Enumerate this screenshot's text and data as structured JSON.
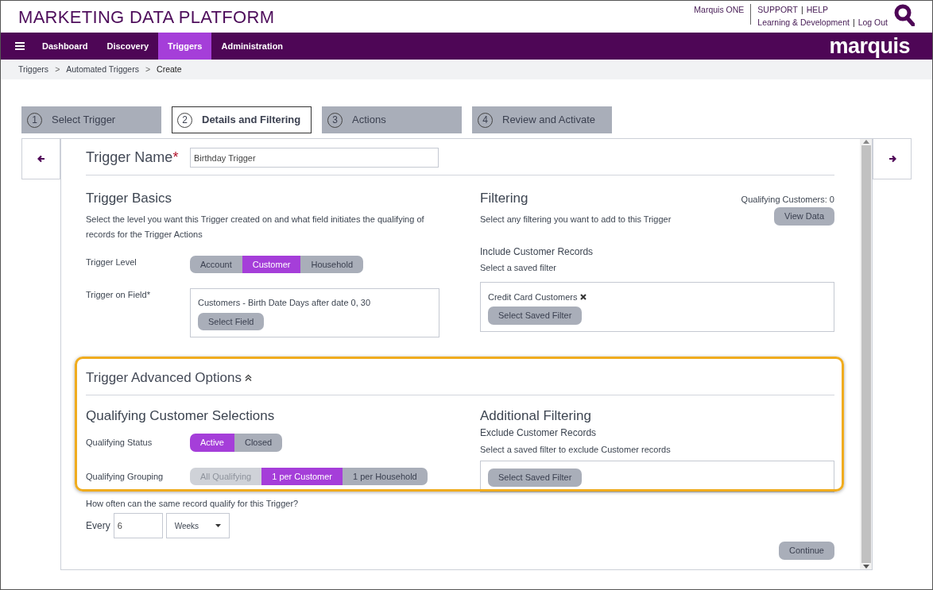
{
  "header": {
    "title": "MARKETING DATA PLATFORM",
    "account_link": "Marquis ONE",
    "link_rows": [
      [
        {
          "kind": "link",
          "label": "SUPPORT"
        },
        {
          "kind": "separator",
          "label": "|"
        },
        {
          "kind": "link",
          "label": "HELP"
        }
      ],
      [
        {
          "kind": "link",
          "label": "Learning & Development"
        },
        {
          "kind": "separator",
          "label": "|"
        },
        {
          "kind": "link",
          "label": "Log Out"
        }
      ]
    ]
  },
  "navbar": {
    "items": [
      {
        "label": "Dashboard",
        "selected": false
      },
      {
        "label": "Discovery",
        "selected": false
      },
      {
        "label": "Triggers",
        "selected": true
      },
      {
        "label": "Administration",
        "selected": false
      }
    ],
    "logo": "marquis"
  },
  "breadcrumb": [
    {
      "kind": "link",
      "label": "Triggers"
    },
    {
      "kind": "separator",
      "label": ">"
    },
    {
      "kind": "link",
      "label": "Automated Triggers"
    },
    {
      "kind": "separator",
      "label": ">"
    },
    {
      "kind": "current",
      "label": "Create"
    }
  ],
  "steps": [
    {
      "number": "1",
      "label": "Select Trigger",
      "selected": false
    },
    {
      "number": "2",
      "label": "Details and Filtering",
      "selected": true
    },
    {
      "number": "3",
      "label": "Actions",
      "selected": false
    },
    {
      "number": "4",
      "label": "Review and Activate",
      "selected": false
    }
  ],
  "trigger_name": {
    "label": "Trigger Name",
    "required_mark": "*",
    "value": "Birthday Trigger"
  },
  "trigger_basics": {
    "title": "Trigger Basics",
    "description": "Select the level you want this Trigger created on and what field initiates the qualifying of records for the Trigger Actions",
    "level_label": "Trigger Level",
    "level_options": [
      {
        "label": "Account",
        "selected": false,
        "disabled": false
      },
      {
        "label": "Customer",
        "selected": true,
        "disabled": false
      },
      {
        "label": "Household",
        "selected": false,
        "disabled": false
      }
    ],
    "field_label": "Trigger on Field",
    "field_required_mark": "*",
    "field_value": "Customers - Birth Date Days after date 0, 30",
    "field_button": "Select Field"
  },
  "filtering": {
    "title": "Filtering",
    "description": "Select any filtering you want to add to this Trigger",
    "count_text": "Qualifying Customers: 0",
    "view_button": "View Data",
    "include_title": "Include Customer Records",
    "include_hint": "Select a saved filter",
    "filters": [
      {
        "label": "Credit Card Customers"
      }
    ],
    "filter_button": "Select Saved Filter"
  },
  "advanced_options": {
    "title": "Trigger Advanced Options",
    "expanded": true,
    "highlighted": true,
    "selections_title": "Qualifying Customer Selections",
    "status_label": "Qualifying Status",
    "status_options": [
      {
        "label": "Active",
        "selected": true,
        "disabled": false
      },
      {
        "label": "Closed",
        "selected": false,
        "disabled": false
      }
    ],
    "grouping_label": "Qualifying Grouping",
    "grouping_options": [
      {
        "label": "All Qualifying",
        "selected": false,
        "disabled": true
      },
      {
        "label": "1 per Customer",
        "selected": true,
        "disabled": false
      },
      {
        "label": "1 per Household",
        "selected": false,
        "disabled": false
      }
    ],
    "frequency_question": "How often can the same record qualify for this Trigger?",
    "every_label": "Every",
    "every_value": "6",
    "unit_value": "Weeks",
    "additional_title": "Additional Filtering",
    "exclude_title": "Exclude Customer Records",
    "exclude_hint": "Select a saved filter to exclude Customer records",
    "exclude_button": "Select Saved Filter"
  },
  "continue_button": "Continue"
}
